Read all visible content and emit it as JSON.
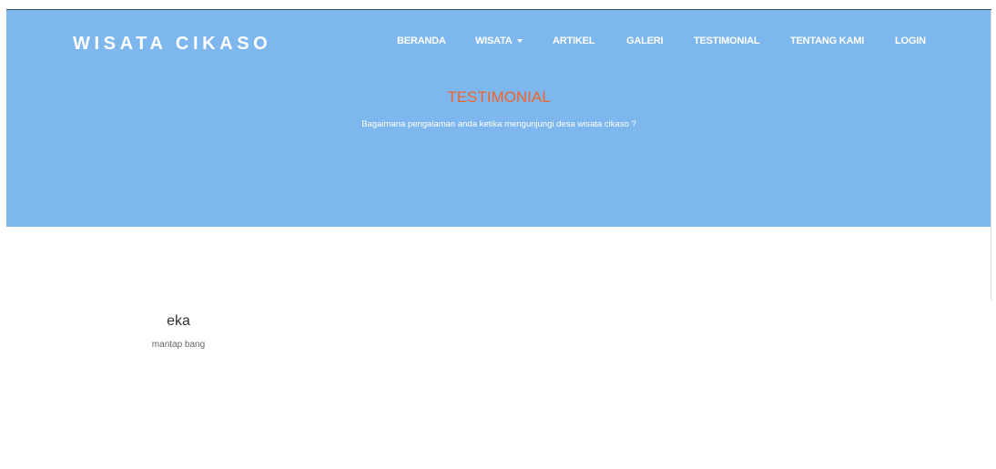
{
  "header": {
    "brand": "WISATA CIKASO",
    "nav": [
      {
        "label": "BERANDA"
      },
      {
        "label": "WISATA"
      },
      {
        "label": "ARTIKEL"
      },
      {
        "label": "GALERI"
      },
      {
        "label": "TESTIMONIAL"
      },
      {
        "label": "TENTANG KAMI"
      },
      {
        "label": "LOGIN"
      }
    ]
  },
  "hero": {
    "title": "TESTIMONIAL",
    "subtitle": "Bagaimana pengalaman anda ketika mengunjungi desa wisata cikaso ?"
  },
  "testimonials": [
    {
      "name": "eka",
      "text": "mantap bang"
    }
  ],
  "colors": {
    "hero_background": "#7eb7ee",
    "title_accent": "#f2632a",
    "nav_text": "#ffffff"
  },
  "icons": {
    "wisata_dropdown": "caret-down-icon"
  }
}
